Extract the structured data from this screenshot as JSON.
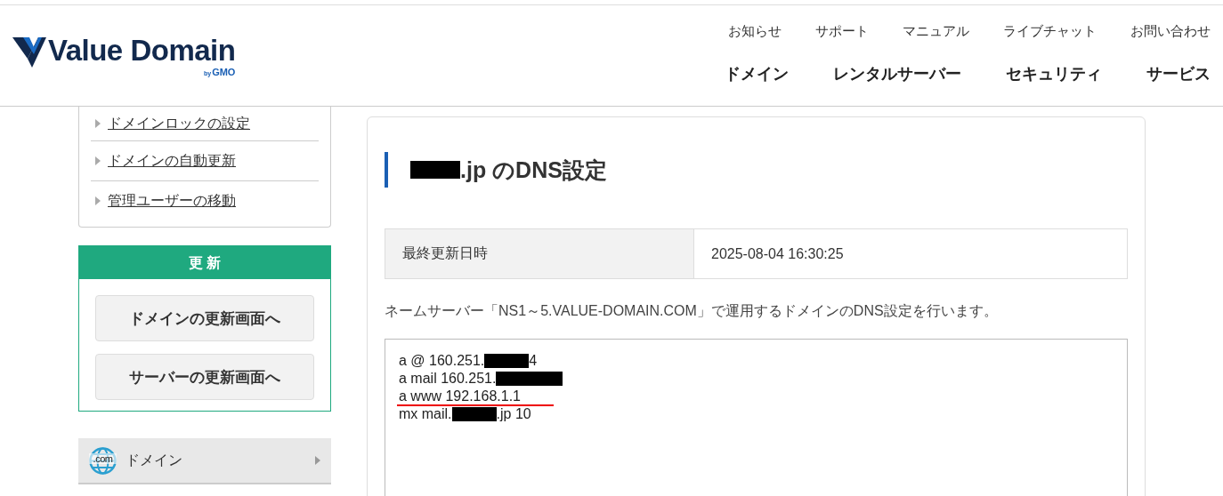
{
  "header": {
    "logo": {
      "name": "Value Domain",
      "byline": "by",
      "brand": "GMO"
    },
    "top_links": [
      "お知らせ",
      "サポート",
      "マニュアル",
      "ライブチャット",
      "お問い合わせ"
    ],
    "nav": [
      "ドメイン",
      "レンタルサーバー",
      "セキュリティ",
      "サービス"
    ]
  },
  "sidebar": {
    "domain_links": [
      "ドメインロックの設定",
      "ドメインの自動更新",
      "管理ユーザーの移動"
    ],
    "renewal": {
      "title": "更 新",
      "buttons": [
        "ドメインの更新画面へ",
        "サーバーの更新画面へ"
      ]
    },
    "menu": [
      {
        "label": "ドメイン",
        "icon_text": ".com"
      }
    ]
  },
  "main": {
    "title": [
      {
        "kind": "redaction"
      },
      {
        "kind": "text",
        "text": ".jp のDNS設定"
      }
    ],
    "info_table": [
      {
        "label": "最終更新日時",
        "value": "2025-08-04 16:30:25"
      }
    ],
    "description": "ネームサーバー「NS1～5.VALUE-DOMAIN.COM」で運用するドメインのDNS設定を行います。",
    "records": [
      {
        "underlined": false,
        "parts": [
          {
            "kind": "text",
            "text": "a @ 160.251."
          },
          {
            "kind": "redaction"
          },
          {
            "kind": "text",
            "text": "4"
          }
        ]
      },
      {
        "underlined": false,
        "parts": [
          {
            "kind": "text",
            "text": "a mail 160.251."
          },
          {
            "kind": "redaction"
          }
        ]
      },
      {
        "underlined": true,
        "parts": [
          {
            "kind": "text",
            "text": "a www 192.168.1.1"
          }
        ]
      },
      {
        "underlined": false,
        "parts": [
          {
            "kind": "text",
            "text": "mx mail."
          },
          {
            "kind": "redaction"
          },
          {
            "kind": "text",
            "text": ".jp 10"
          }
        ]
      }
    ]
  }
}
